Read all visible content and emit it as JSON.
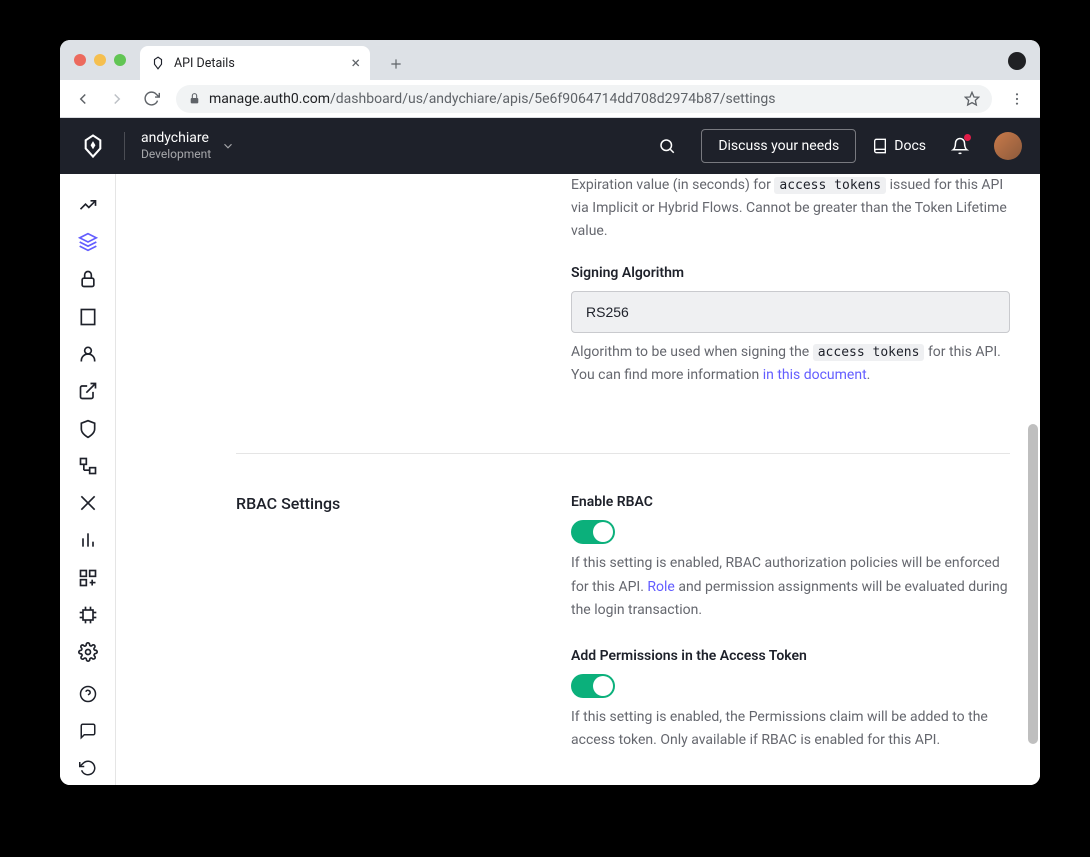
{
  "browser": {
    "tab_title": "API Details",
    "url_host": "manage.auth0.com",
    "url_path": "/dashboard/us/andychiare/apis/5e6f9064714dd708d2974b87/settings"
  },
  "header": {
    "tenant_name": "andychiare",
    "environment": "Development",
    "discuss_label": "Discuss your needs",
    "docs_label": "Docs"
  },
  "sidebar": {
    "items": [
      {
        "name": "activity",
        "active": false
      },
      {
        "name": "applications",
        "active": true
      },
      {
        "name": "authentication",
        "active": false
      },
      {
        "name": "organizations",
        "active": false
      },
      {
        "name": "users",
        "active": false
      },
      {
        "name": "branding",
        "active": false
      },
      {
        "name": "security",
        "active": false
      },
      {
        "name": "actions",
        "active": false
      },
      {
        "name": "forms",
        "active": false
      },
      {
        "name": "monitoring",
        "active": false
      },
      {
        "name": "marketplace",
        "active": false
      },
      {
        "name": "extensions",
        "active": false
      },
      {
        "name": "settings",
        "active": false
      }
    ],
    "lower": [
      {
        "name": "help"
      },
      {
        "name": "feedback"
      },
      {
        "name": "history"
      }
    ]
  },
  "content": {
    "expiration": {
      "desc_pre": "Expiration value (in seconds) for ",
      "desc_code": "access tokens",
      "desc_post": " issued for this API via Implicit or Hybrid Flows. Cannot be greater than the Token Lifetime value."
    },
    "signing": {
      "label": "Signing Algorithm",
      "value": "RS256",
      "desc_pre": "Algorithm to be used when signing the ",
      "desc_code": "access tokens",
      "desc_mid": " for this API. You can find more information ",
      "desc_link": "in this document",
      "desc_end": "."
    },
    "rbac": {
      "section_title": "RBAC Settings",
      "enable": {
        "label": "Enable RBAC",
        "enabled": true,
        "desc_pre": "If this setting is enabled, RBAC authorization policies will be enforced for this API. ",
        "desc_link": "Role",
        "desc_post": " and permission assignments will be evaluated during the login transaction."
      },
      "permissions": {
        "label": "Add Permissions in the Access Token",
        "enabled": true,
        "desc": "If this setting is enabled, the Permissions claim will be added to the access token. Only available if RBAC is enabled for this API."
      }
    }
  }
}
